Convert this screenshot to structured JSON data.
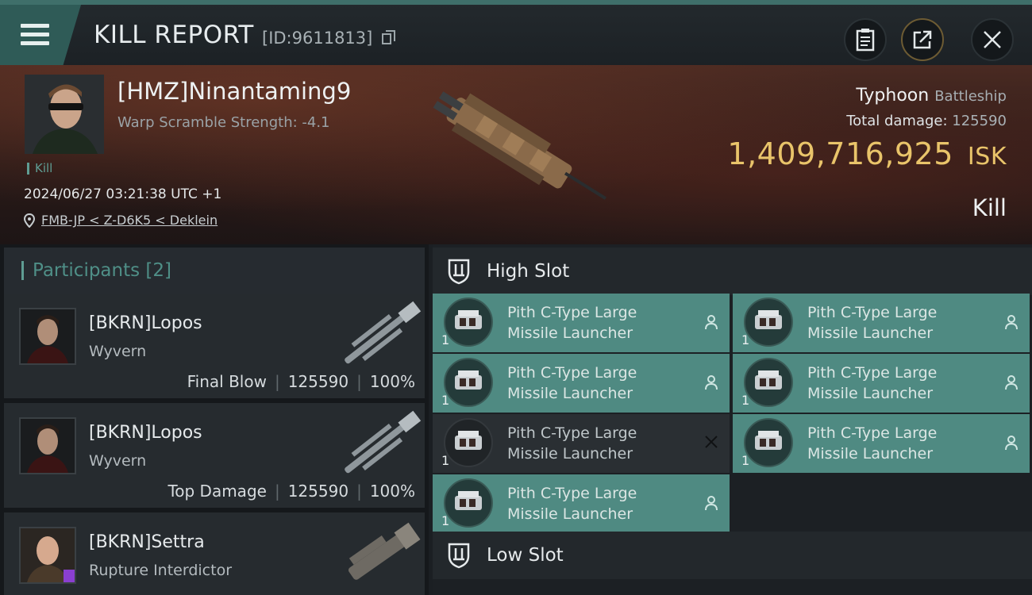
{
  "header": {
    "title": "KILL REPORT",
    "id": "[ID:9611813]",
    "icons": [
      "menu-icon",
      "copy-icon",
      "clipboard-icon",
      "share-icon",
      "close-icon"
    ]
  },
  "victim": {
    "name": "[HMZ]Ninantaming9",
    "warp": "Warp Scramble Strength: -4.1",
    "tag": "Kill",
    "datetime": "2024/06/27 03:21:38 UTC +1",
    "location": "FMB-JP < Z-D6K5 < Deklein",
    "ship": "Typhoon",
    "ship_class": "Battleship",
    "total_damage_label": "Total damage:",
    "total_damage": "125590",
    "isk_value": "1,409,716,925",
    "isk_unit": "ISK",
    "result": "Kill"
  },
  "participants": {
    "title": "Participants [2]",
    "items": [
      {
        "name": "[BKRN]Lopos",
        "ship": "Wyvern",
        "role": "Final Blow",
        "damage": "125590",
        "percent": "100%"
      },
      {
        "name": "[BKRN]Lopos",
        "ship": "Wyvern",
        "role": "Top Damage",
        "damage": "125590",
        "percent": "100%"
      },
      {
        "name": "[BKRN]Settra",
        "ship": "Rupture Interdictor"
      }
    ]
  },
  "slots": {
    "high_title": "High Slot",
    "low_title": "Low Slot",
    "modules": [
      {
        "l1": "Pith C-Type Large",
        "l2": "Missile Launcher",
        "qty": "1",
        "state": "fitted"
      },
      {
        "l1": "Pith C-Type Large",
        "l2": "Missile Launcher",
        "qty": "1",
        "state": "fitted"
      },
      {
        "l1": "Pith C-Type Large",
        "l2": "Missile Launcher",
        "qty": "1",
        "state": "fitted"
      },
      {
        "l1": "Pith C-Type Large",
        "l2": "Missile Launcher",
        "qty": "1",
        "state": "fitted"
      },
      {
        "l1": "Pith C-Type Large",
        "l2": "Missile Launcher",
        "qty": "1",
        "state": "destroyed"
      },
      {
        "l1": "Pith C-Type Large",
        "l2": "Missile Launcher",
        "qty": "1",
        "state": "fitted"
      },
      {
        "l1": "Pith C-Type Large",
        "l2": "Missile Launcher",
        "qty": "1",
        "state": "fitted"
      }
    ]
  },
  "colors": {
    "accent_teal": "#4f8a82",
    "isk_gold": "#e9c46a",
    "panel": "#262b2f"
  }
}
